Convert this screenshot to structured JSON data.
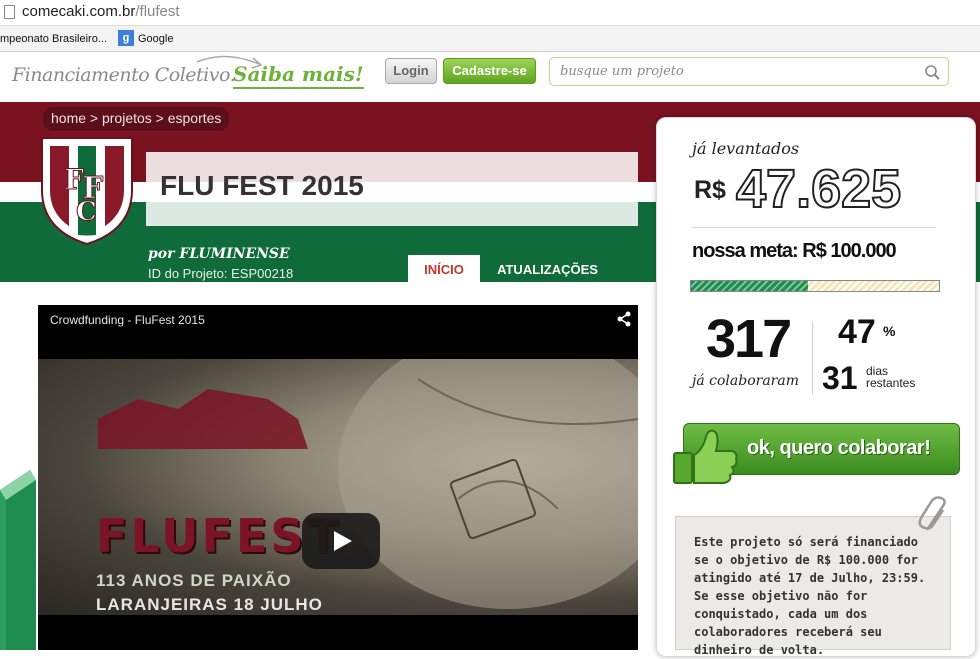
{
  "browser": {
    "url_host": "comecaki.com.br",
    "url_path": "/flufest",
    "bookmarks": [
      "mpeonato Brasileiro...",
      "Google"
    ]
  },
  "header": {
    "tagline": "Financiamento Coletivo.",
    "saiba_mais": "Saiba mais!",
    "login_label": "Login",
    "signup_label": "Cadastre-se",
    "search_placeholder": "busque um projeto"
  },
  "project": {
    "breadcrumb": "home > projetos > esportes",
    "title": "FLU FEST 2015",
    "author": "por FLUMINENSE",
    "project_id": "ID do Projeto: ESP00218",
    "tabs": [
      "INÍCIO",
      "ATUALIZAÇÕES"
    ]
  },
  "video": {
    "title": "Crowdfunding - FluFest 2015",
    "overlay_title": "FLUFEST",
    "overlay_line1": "113 ANOS DE PAIXÃO",
    "overlay_line2": "LARANJEIRAS 18 JULHO"
  },
  "funding": {
    "raised_label": "já levantados",
    "currency": "R$",
    "raised_amount": "47.625",
    "goal_text": "nossa meta: R$ 100.000",
    "progress_fraction": 0.47,
    "backers_count": "317",
    "backers_label": "já colaboraram",
    "percent": "47",
    "percent_symbol": "%",
    "days_left": "31",
    "days_label_1": "dias",
    "days_label_2": "restantes",
    "cta_label": "ok, quero colaborar!",
    "note": "Este projeto só será financiado se o objetivo de R$ 100.000 for atingido até 17 de Julho, 23:59. Se esse objetivo não for conquistado, cada um dos colaboradores receberá seu dinheiro de volta."
  },
  "colors": {
    "brand_green": "#6fb23a",
    "fluminense_red": "#7a1220",
    "fluminense_green": "#0f6b3a"
  }
}
